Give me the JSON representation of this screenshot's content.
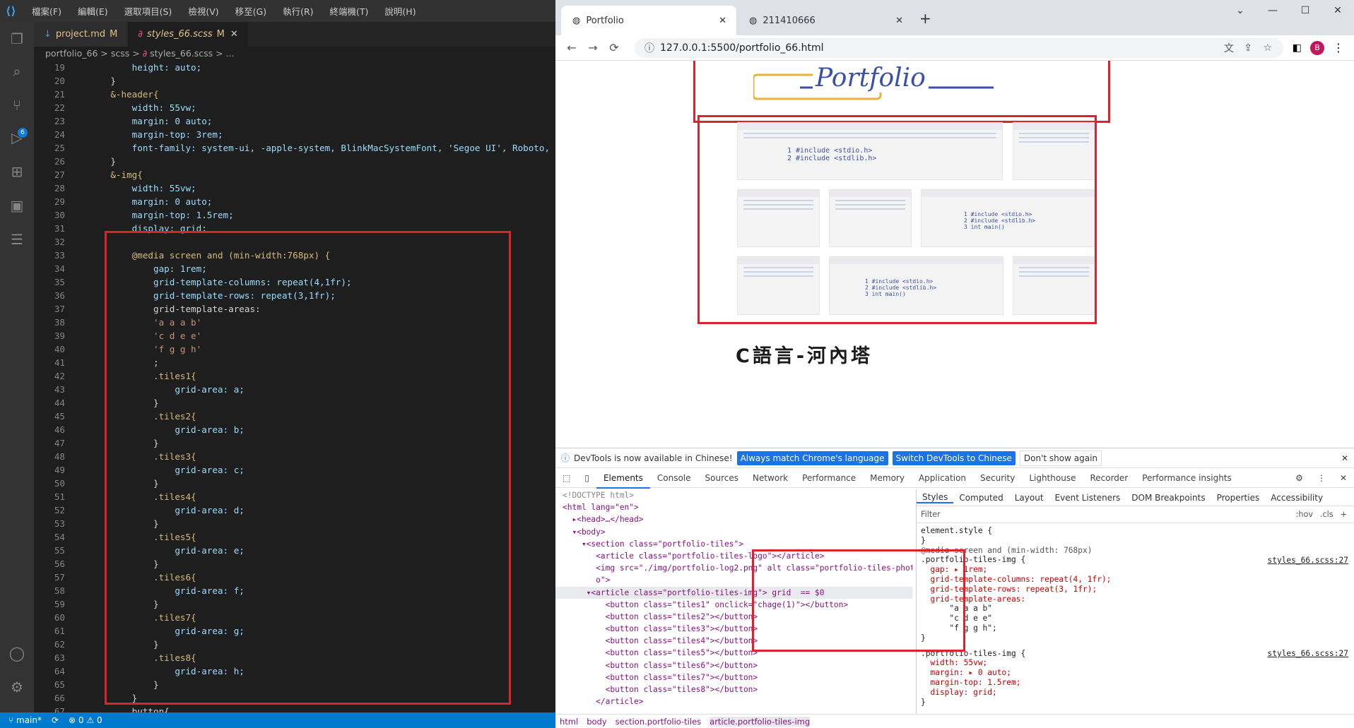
{
  "vscode": {
    "menu": [
      "檔案(F)",
      "編輯(E)",
      "選取項目(S)",
      "檢視(V)",
      "移至(G)",
      "執行(R)",
      "終端機(T)",
      "說明(H)"
    ],
    "tabs": [
      {
        "name": "project.md",
        "status": "M"
      },
      {
        "name": "styles_66.scss",
        "status": "M"
      }
    ],
    "breadcrumb": [
      "portfolio_66",
      "scss",
      "styles_66.scss",
      "..."
    ],
    "scm_badge": "6",
    "code_lines": [
      {
        "n": "19",
        "t": "        height: auto;"
      },
      {
        "n": "20",
        "t": "    }"
      },
      {
        "n": "21",
        "t": "    &-header{"
      },
      {
        "n": "22",
        "t": "        width: 55vw;"
      },
      {
        "n": "23",
        "t": "        margin: 0 auto;"
      },
      {
        "n": "24",
        "t": "        margin-top: 3rem;"
      },
      {
        "n": "25",
        "t": "        font-family: system-ui, -apple-system, BlinkMacSystemFont, 'Segoe UI', Roboto, "
      },
      {
        "n": "26",
        "t": "    }"
      },
      {
        "n": "27",
        "t": "    &-img{"
      },
      {
        "n": "28",
        "t": "        width: 55vw;"
      },
      {
        "n": "29",
        "t": "        margin: 0 auto;"
      },
      {
        "n": "30",
        "t": "        margin-top: 1.5rem;"
      },
      {
        "n": "31",
        "t": "        display: grid;"
      },
      {
        "n": "32",
        "t": ""
      },
      {
        "n": "33",
        "t": "        @media screen and (min-width:768px) {"
      },
      {
        "n": "34",
        "t": "            gap: 1rem;"
      },
      {
        "n": "35",
        "t": "            grid-template-columns: repeat(4,1fr);"
      },
      {
        "n": "36",
        "t": "            grid-template-rows: repeat(3,1fr);"
      },
      {
        "n": "37",
        "t": "            grid-template-areas:"
      },
      {
        "n": "38",
        "t": "            'a a a b'"
      },
      {
        "n": "39",
        "t": "            'c d e e'"
      },
      {
        "n": "40",
        "t": "            'f g g h'"
      },
      {
        "n": "41",
        "t": "            ;"
      },
      {
        "n": "42",
        "t": "            .tiles1{"
      },
      {
        "n": "43",
        "t": "                grid-area: a;"
      },
      {
        "n": "44",
        "t": "            }"
      },
      {
        "n": "45",
        "t": "            .tiles2{"
      },
      {
        "n": "46",
        "t": "                grid-area: b;"
      },
      {
        "n": "47",
        "t": "            }"
      },
      {
        "n": "48",
        "t": "            .tiles3{"
      },
      {
        "n": "49",
        "t": "                grid-area: c;"
      },
      {
        "n": "50",
        "t": "            }"
      },
      {
        "n": "51",
        "t": "            .tiles4{"
      },
      {
        "n": "52",
        "t": "                grid-area: d;"
      },
      {
        "n": "53",
        "t": "            }"
      },
      {
        "n": "54",
        "t": "            .tiles5{"
      },
      {
        "n": "55",
        "t": "                grid-area: e;"
      },
      {
        "n": "56",
        "t": "            }"
      },
      {
        "n": "57",
        "t": "            .tiles6{"
      },
      {
        "n": "58",
        "t": "                grid-area: f;"
      },
      {
        "n": "59",
        "t": "            }"
      },
      {
        "n": "60",
        "t": "            .tiles7{"
      },
      {
        "n": "61",
        "t": "                grid-area: g;"
      },
      {
        "n": "62",
        "t": "            }"
      },
      {
        "n": "63",
        "t": "            .tiles8{"
      },
      {
        "n": "64",
        "t": "                grid-area: h;"
      },
      {
        "n": "65",
        "t": "            }"
      },
      {
        "n": "66",
        "t": "        }"
      },
      {
        "n": "67",
        "t": "        button{"
      }
    ],
    "status": {
      "branch": "main*",
      "errors": "0",
      "warnings": "0"
    }
  },
  "chrome": {
    "tabs": [
      "Portfolio",
      "211410666"
    ],
    "url": "127.0.0.1:5500/portfolio_66.html",
    "avatar": "B",
    "page": {
      "logo_text": "Portfolio",
      "heading": "C語言-河內塔"
    },
    "devtools": {
      "info": "DevTools is now available in Chinese!",
      "btn1": "Always match Chrome's language",
      "btn2": "Switch DevTools to Chinese",
      "btn3": "Don't show again",
      "tabs": [
        "Elements",
        "Console",
        "Sources",
        "Network",
        "Performance",
        "Memory",
        "Application",
        "Security",
        "Lighthouse",
        "Recorder",
        "Performance insights"
      ],
      "style_tabs": [
        "Styles",
        "Computed",
        "Layout",
        "Event Listeners",
        "DOM Breakpoints",
        "Properties",
        "Accessibility"
      ],
      "filter": "Filter",
      "hov": ":hov",
      "cls": ".cls",
      "dom": [
        "<!DOCTYPE html>",
        "<html lang=\"en\">",
        "  ▸<head>…</head>",
        "  ▾<body>",
        "    ▾<section class=\"portfolio-tiles\">",
        "       <article class=\"portfolio-tiles-logo\"></article>",
        "       <img src=\"./img/portfolio-log2.png\" alt class=\"portfolio-tiles-phot",
        "       o\">",
        "     ▾<article class=\"portfolio-tiles-img\"> grid  == $0",
        "         <button class=\"tiles1\" onclick=\"chage(1)\"></button>",
        "         <button class=\"tiles2\"></button>",
        "         <button class=\"tiles3\"></button>",
        "         <button class=\"tiles4\"></button>",
        "         <button class=\"tiles5\"></button>",
        "         <button class=\"tiles6\"></button>",
        "         <button class=\"tiles7\"></button>",
        "         <button class=\"tiles8\"></button>",
        "       </article>"
      ],
      "styles": [
        "element.style {",
        "}",
        "@media screen and (min-width: 768px)",
        ".portfolio-tiles-img {",
        "  gap: ▸ 1rem;",
        "  grid-template-columns: repeat(4, 1fr);",
        "  grid-template-rows: repeat(3, 1fr);",
        "  grid-template-areas:",
        "      \"a a a b\"",
        "      \"c d e e\"",
        "      \"f g g h\";",
        "}",
        ".portfolio-tiles-img {",
        "  width: 55vw;",
        "  margin: ▸ 0 auto;",
        "  margin-top: 1.5rem;",
        "  display: grid;",
        "}"
      ],
      "src1": "styles_66.scss:27",
      "src2": "styles_66.scss:27",
      "crumbs": [
        "html",
        "body",
        "section.portfolio-tiles",
        "article.portfolio-tiles-img"
      ]
    }
  }
}
